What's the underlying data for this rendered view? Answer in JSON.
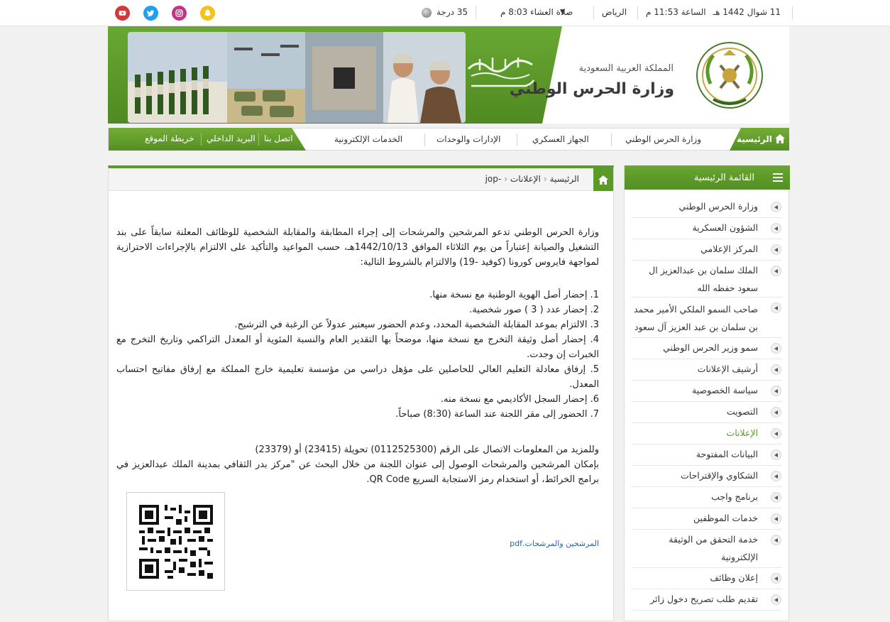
{
  "topbar": {
    "date": "11 شوال 1442 هـ",
    "time": "الساعة 11:53 م",
    "city": "الرياض",
    "prayer": "صلاة العشاء 8:03 م",
    "temperature": "35 درجة",
    "social": [
      {
        "name": "snapchat-icon",
        "color": "#f4c21a"
      },
      {
        "name": "instagram-icon",
        "color": "#c13584"
      },
      {
        "name": "twitter-icon",
        "color": "#1da1f2"
      },
      {
        "name": "youtube-icon",
        "color": "#d13a3a"
      }
    ]
  },
  "header": {
    "country": "المملكة العربية السعودية",
    "ministry": "وزارة الحرس الوطني"
  },
  "nav": {
    "home": "الرئيسية",
    "items": [
      "وزارة الحرس الوطني",
      "الجهاز العسكري",
      "الإدارات والوحدات",
      "الخدمات الإلكترونية"
    ],
    "quick": [
      "اتصل بنا",
      "البريد الداخلي",
      "خريطة الموقع"
    ]
  },
  "breadcrumb": {
    "home": "الرئيسية",
    "section": "الإعلانات",
    "current": "-jop"
  },
  "article": {
    "intro": "وزارة الحرس الوطني تدعو المرشحين والمرشحات إلى إجراء المطابقة والمقابلة الشخصية للوظائف المعلنة سابقاً على بند التشغيل والصيانة إعتباراً من يوم الثلاثاء الموافق 1442/10/13هـ، حسب المواعيد والتأكيد على الالتزام بالإجراءات الاحترازية لمواجهة فايروس كورونا (كوفيد -19) والالتزام بالشروط التالية:",
    "conditions": [
      "1. إحضار أصل الهوية الوطنية مع نسخة منها.",
      "2. إحضار عدد ( 3 ) صور شخصية.",
      "3. الالتزام بموعد المقابلة الشخصية المحدد، وعدم الحضور سيعتبر عدولاً عن الرغبة في الترشيح.",
      "4. إحضار أصل وثيقة التخرج مع نسخة منها، موضحاً بها التقدير العام والنسبة المئوية أو المعدل التراكمي وتاريخ التخرج مع الخبرات إن وجدت.",
      "5. إرفاق معادلة التعليم العالي للحاصلين على مؤهل دراسي من مؤسسة تعليمية خارج المملكة مع إرفاق مفاتيح احتساب المعدل.",
      "6. إحضار السجل الأكاديمي مع نسخة منه.",
      "7. الحضور إلى مقر اللجنة عند الساعة (8:30) صباحاً."
    ],
    "contact": "وللمزيد من المعلومات الاتصال على الرقم (0112525300) تحويلة (23415) أو (23379)",
    "directions": "بإمكان المرشحين والمرشحات الوصول إلى عنوان اللجنة من خلال البحث عن \"مركز بدر الثقافي بمدينة الملك عبدالعزيز في برامج الخرائط، أو استخدام رمز الاستجابة السريع QR Code.",
    "attachment": "المرشحين والمرشحات.pdf"
  },
  "sidebar": {
    "title": "القائمة الرئيسية",
    "items": [
      {
        "label": "وزارة الحرس الوطني"
      },
      {
        "label": "الشؤون العسكرية"
      },
      {
        "label": "المركز الإعلامي"
      },
      {
        "label": "الملك سلمان بن عبدالعزيز ال سعود حفظه الله"
      },
      {
        "label": "صاحب السمو الملكي الأمير محمد بن سلمان بن عبد العزيز آل سعود"
      },
      {
        "label": "سمو وزير الحرس الوطني"
      },
      {
        "label": "أرشيف الإعلانات"
      },
      {
        "label": "سياسة الخصوصية"
      },
      {
        "label": "التصويت"
      },
      {
        "label": "الإعلانات",
        "active": true
      },
      {
        "label": "البيانات المفتوحة"
      },
      {
        "label": "الشكاوي والإقتراحات"
      },
      {
        "label": "برنامج واجب"
      },
      {
        "label": "خدمات الموظفين"
      },
      {
        "label": "خدمة التحقق من الوثيقة الإلكترونية"
      },
      {
        "label": "إعلان وظائف"
      },
      {
        "label": "تقديم طلب تصريح دخول زائر"
      }
    ]
  },
  "colors": {
    "brand_green": "#5a9a28",
    "link_blue": "#2b63b2"
  }
}
